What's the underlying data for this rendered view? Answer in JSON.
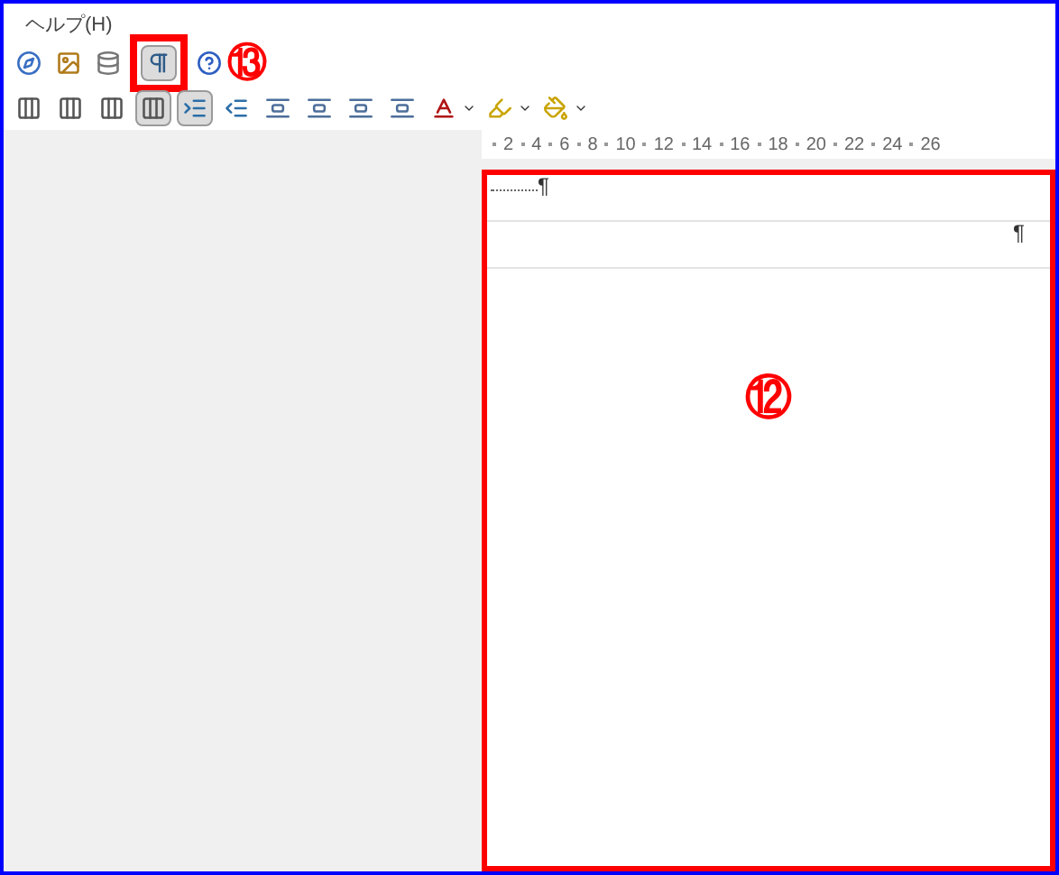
{
  "menu": [
    {
      "label": "ヘルプ(H)"
    }
  ],
  "toolbar_1": [
    {
      "kind": "compass",
      "pressed": false
    },
    {
      "kind": "picture",
      "pressed": false
    },
    {
      "kind": "database",
      "pressed": false
    },
    {
      "kind": "pilcrow",
      "pressed": true,
      "highlighted": true
    },
    {
      "kind": "help",
      "pressed": false
    }
  ],
  "callout_13": "⑬",
  "toolbar_2": [
    {
      "kind": "columns",
      "pressed": false,
      "has_menu": false
    },
    {
      "kind": "columns",
      "pressed": false,
      "has_menu": false
    },
    {
      "kind": "columns",
      "pressed": false,
      "has_menu": false
    },
    {
      "kind": "columns",
      "pressed": true,
      "has_menu": false
    },
    {
      "kind": "indent",
      "pressed": true,
      "has_menu": false
    },
    {
      "kind": "outdent",
      "pressed": false,
      "has_menu": false
    },
    {
      "kind": "spacing",
      "pressed": false,
      "has_menu": false
    },
    {
      "kind": "spacing",
      "pressed": false,
      "has_menu": false
    },
    {
      "kind": "spacing",
      "pressed": false,
      "has_menu": false
    },
    {
      "kind": "spacing",
      "pressed": false,
      "has_menu": false
    },
    {
      "kind": "font-color",
      "pressed": false,
      "has_menu": true
    },
    {
      "kind": "highlight",
      "pressed": false,
      "has_menu": true
    },
    {
      "kind": "shading",
      "pressed": false,
      "has_menu": true
    }
  ],
  "ruler": [
    "2",
    "4",
    "6",
    "8",
    "10",
    "12",
    "14",
    "16",
    "18",
    "20",
    "22",
    "24",
    "26"
  ],
  "document": {
    "highlighted": true,
    "paragraphs": [
      {
        "mark": "¶",
        "kind": "leader",
        "leader": true
      },
      {
        "mark": "¶",
        "kind": "end",
        "leader": false
      }
    ]
  },
  "callout_12": "⑫"
}
